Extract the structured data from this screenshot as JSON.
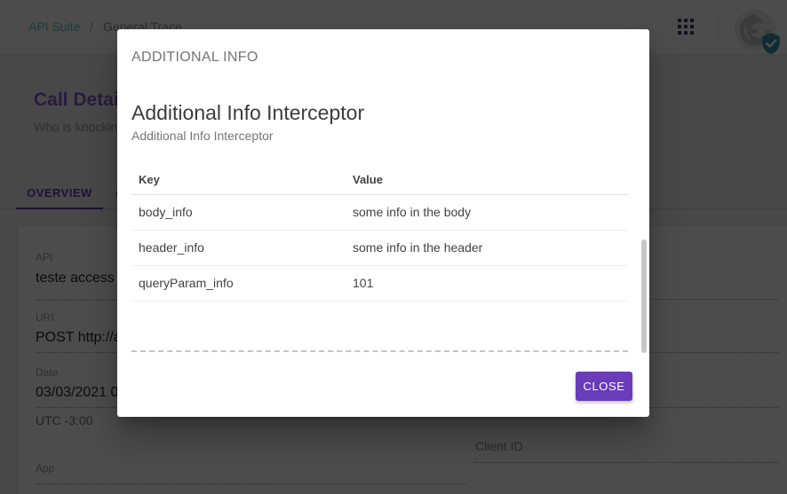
{
  "topbar": {
    "breadcrumb": {
      "parent": "API Suite",
      "separator": "/",
      "current": "General Trace"
    },
    "icons": {
      "apps": "apps-grid-icon",
      "account": "avatar-logo-icon",
      "verified": "shield-check-icon"
    }
  },
  "page": {
    "title": "Call Details",
    "subtitle": "Who is knocking",
    "tabs": [
      {
        "label": "OVERVIEW",
        "active": true
      },
      {
        "label": "C",
        "active": false
      }
    ],
    "details": {
      "left": [
        {
          "label": "API",
          "value": "teste access"
        },
        {
          "label": "URI",
          "value": "POST http://a"
        },
        {
          "label": "Date",
          "value": "03/03/2021 0"
        }
      ],
      "timezone": "UTC -3:00",
      "app_label": "App",
      "client_id_label": "Client ID"
    }
  },
  "modal": {
    "eyebrow": "ADDITIONAL INFO",
    "title": "Additional Info Interceptor",
    "subtitle": "Additional Info Interceptor",
    "table": {
      "columns": [
        "Key",
        "Value"
      ],
      "rows": [
        [
          "body_info",
          "some info in the body"
        ],
        [
          "header_info",
          "some info in the header"
        ],
        [
          "queryParam_info",
          "101"
        ]
      ]
    },
    "close_label": "CLOSE"
  },
  "colors": {
    "accent_purple": "#6a3cb9",
    "link_teal": "#55c4d8",
    "badge_teal": "#2e98a8",
    "backdrop": "rgba(0,0,0,0.70)"
  }
}
